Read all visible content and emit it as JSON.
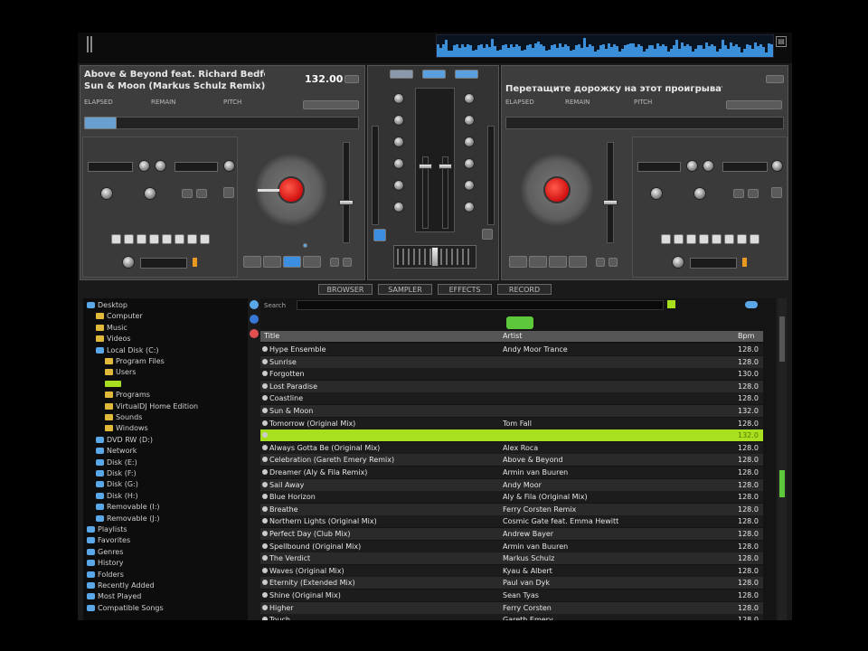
{
  "deck1": {
    "track": "Above & Beyond feat. Richard Bedford",
    "subtitle": "Sun & Moon (Markus Schulz Remix)",
    "bpm": "132.00",
    "info": [
      "ELAPSED",
      "REMAIN",
      "PITCH"
    ]
  },
  "deck2": {
    "track": "Перетащите дорожку на этот проигрыватель, чтоб...",
    "info": [
      "ELAPSED",
      "REMAIN",
      "PITCH"
    ]
  },
  "tabs": [
    "BROWSER",
    "SAMPLER",
    "EFFECTS",
    "RECORD"
  ],
  "browser": {
    "search_label": "Search",
    "columns": [
      "Title",
      "Artist",
      "Bpm"
    ],
    "tree": [
      {
        "label": "Desktop",
        "indent": 0,
        "icon": "drive"
      },
      {
        "label": "Computer",
        "indent": 1,
        "icon": "folder"
      },
      {
        "label": "Music",
        "indent": 1,
        "icon": "folder"
      },
      {
        "label": "Videos",
        "indent": 1,
        "icon": "folder"
      },
      {
        "label": "Local Disk (C:)",
        "indent": 1,
        "icon": "drive"
      },
      {
        "label": "Program Files",
        "indent": 2,
        "icon": "folder"
      },
      {
        "label": "Users",
        "indent": 2,
        "icon": "folder"
      },
      {
        "label": "",
        "indent": 2,
        "icon": "folder-green"
      },
      {
        "label": "Programs",
        "indent": 2,
        "icon": "folder"
      },
      {
        "label": "VirtualDJ Home Edition",
        "indent": 2,
        "icon": "folder"
      },
      {
        "label": "Sounds",
        "indent": 2,
        "icon": "folder"
      },
      {
        "label": "Windows",
        "indent": 2,
        "icon": "folder"
      },
      {
        "label": "DVD RW (D:)",
        "indent": 1,
        "icon": "drive"
      },
      {
        "label": "Network",
        "indent": 1,
        "icon": "drive"
      },
      {
        "label": "Disk (E:)",
        "indent": 1,
        "icon": "drive"
      },
      {
        "label": "Disk (F:)",
        "indent": 1,
        "icon": "drive"
      },
      {
        "label": "Disk (G:)",
        "indent": 1,
        "icon": "drive"
      },
      {
        "label": "Disk (H:)",
        "indent": 1,
        "icon": "drive"
      },
      {
        "label": "Removable (I:)",
        "indent": 1,
        "icon": "drive"
      },
      {
        "label": "Removable (J:)",
        "indent": 1,
        "icon": "drive"
      },
      {
        "label": "Playlists",
        "indent": 0,
        "icon": "drive"
      },
      {
        "label": "Favorites",
        "indent": 0,
        "icon": "drive"
      },
      {
        "label": "Genres",
        "indent": 0,
        "icon": "drive"
      },
      {
        "label": "History",
        "indent": 0,
        "icon": "drive"
      },
      {
        "label": "Folders",
        "indent": 0,
        "icon": "drive"
      },
      {
        "label": "Recently Added",
        "indent": 0,
        "icon": "drive"
      },
      {
        "label": "Most Played",
        "indent": 0,
        "icon": "drive"
      },
      {
        "label": "Compatible Songs",
        "indent": 0,
        "icon": "drive"
      }
    ],
    "rows": [
      {
        "title": "Hype Ensemble",
        "artist": "Andy Moor Trance",
        "bpm": "128.0"
      },
      {
        "title": "Sunrise",
        "artist": "",
        "bpm": "128.0"
      },
      {
        "title": "Forgotten",
        "artist": "",
        "bpm": "130.0"
      },
      {
        "title": "Lost Paradise",
        "artist": "",
        "bpm": "128.0"
      },
      {
        "title": "Coastline",
        "artist": "",
        "bpm": "128.0"
      },
      {
        "title": "Sun & Moon",
        "artist": "",
        "bpm": "132.0"
      },
      {
        "title": "Tomorrow (Original Mix)",
        "artist": "Tom Fall",
        "bpm": "128.0"
      },
      {
        "title": "",
        "artist": "",
        "bpm": "132.0",
        "selected": true
      },
      {
        "title": "Always Gotta Be (Original Mix)",
        "artist": "Alex Roca",
        "bpm": "128.0"
      },
      {
        "title": "Celebration (Gareth Emery Remix)",
        "artist": "Above & Beyond",
        "bpm": "128.0"
      },
      {
        "title": "Dreamer (Aly & Fila Remix)",
        "artist": "Armin van Buuren",
        "bpm": "128.0"
      },
      {
        "title": "Sail Away",
        "artist": "Andy Moor",
        "bpm": "128.0"
      },
      {
        "title": "Blue Horizon",
        "artist": "Aly & Fila (Original Mix)",
        "bpm": "128.0"
      },
      {
        "title": "Breathe",
        "artist": "Ferry Corsten Remix",
        "bpm": "128.0"
      },
      {
        "title": "Northern Lights (Original Mix)",
        "artist": "Cosmic Gate feat. Emma Hewitt",
        "bpm": "128.0"
      },
      {
        "title": "Perfect Day (Club Mix)",
        "artist": "Andrew Bayer",
        "bpm": "128.0"
      },
      {
        "title": "Spellbound (Original Mix)",
        "artist": "Armin van Buuren",
        "bpm": "128.0"
      },
      {
        "title": "The Verdict",
        "artist": "Markus Schulz",
        "bpm": "128.0"
      },
      {
        "title": "Waves (Original Mix)",
        "artist": "Kyau & Albert",
        "bpm": "128.0"
      },
      {
        "title": "Eternity (Extended Mix)",
        "artist": "Paul van Dyk",
        "bpm": "128.0"
      },
      {
        "title": "Shine (Original Mix)",
        "artist": "Sean Tyas",
        "bpm": "128.0"
      },
      {
        "title": "Higher",
        "artist": "Ferry Corsten",
        "bpm": "128.0"
      },
      {
        "title": "Touch",
        "artist": "Gareth Emery",
        "bpm": "128.0"
      }
    ]
  },
  "colors": {
    "accent": "#a8e020",
    "platter_center": "#d01010",
    "panel": "#3d3d3d"
  }
}
